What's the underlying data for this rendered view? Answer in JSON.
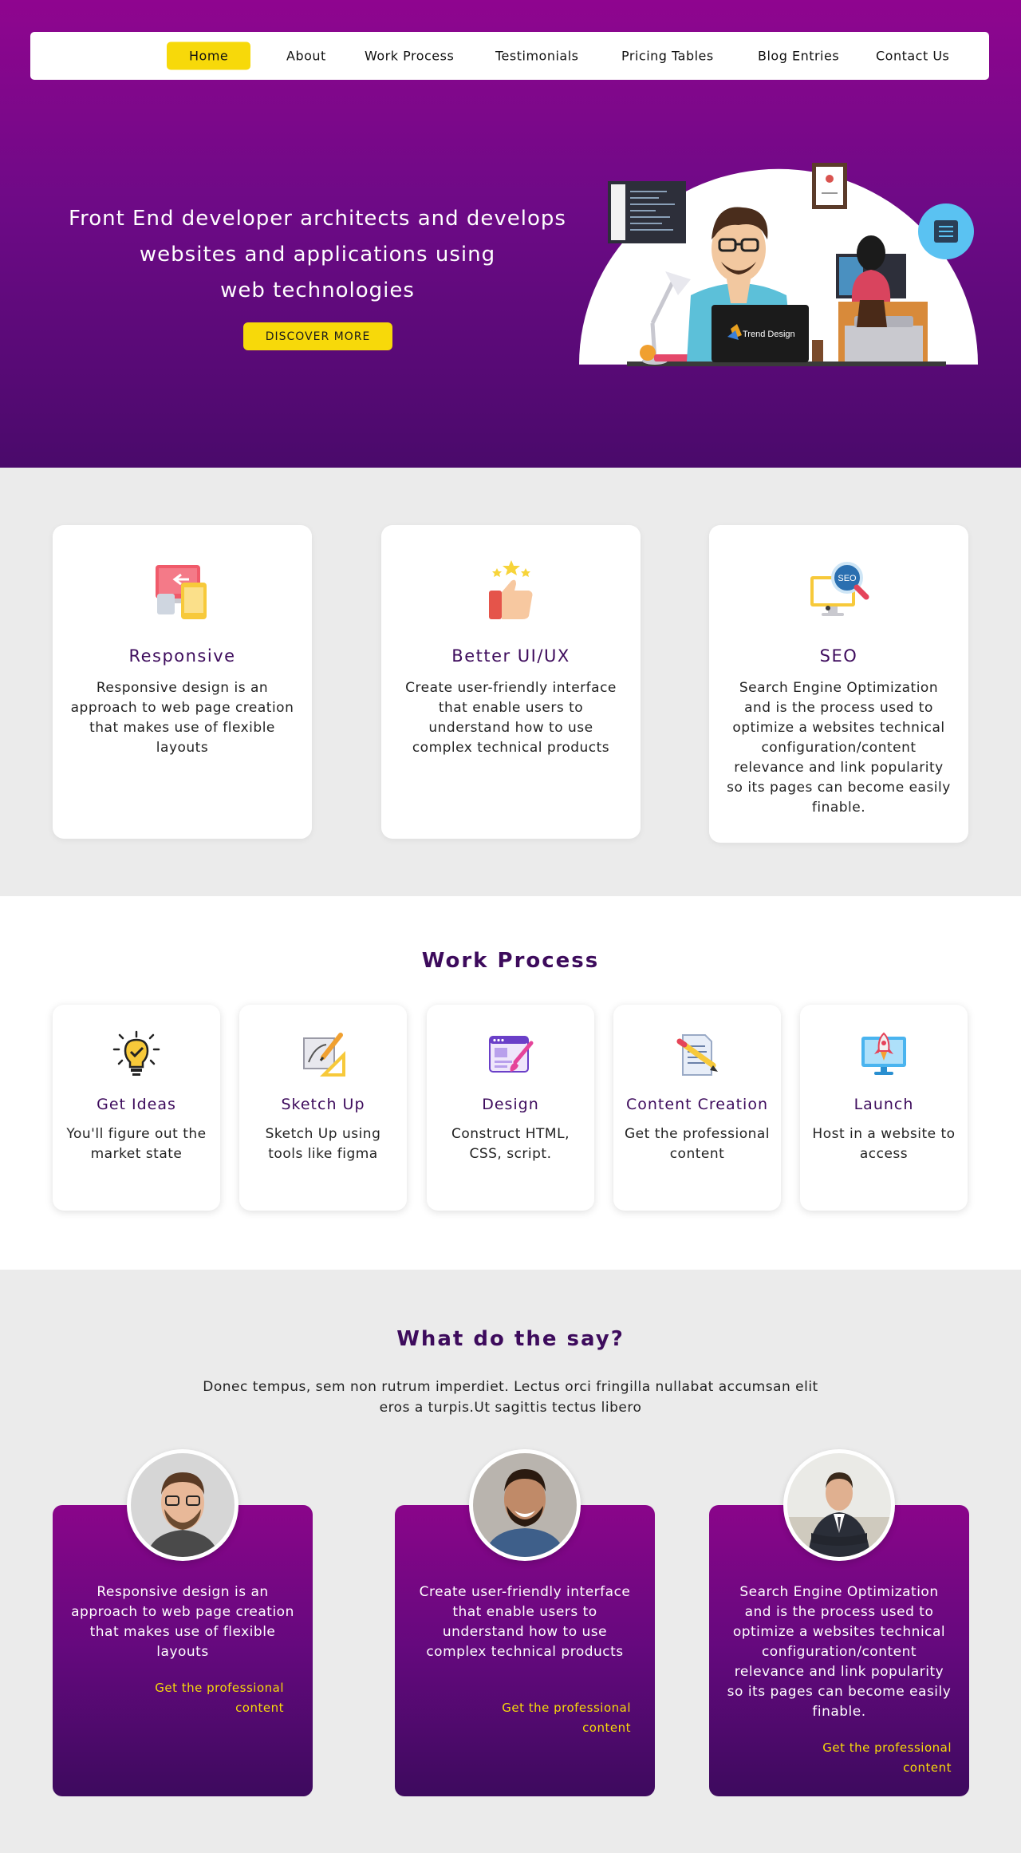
{
  "nav": {
    "items": [
      "Home",
      "About",
      "Work Process",
      "Testimonials",
      "Pricing Tables",
      "Blog Entries",
      "Contact Us"
    ],
    "active": "Home"
  },
  "hero": {
    "title_lines": [
      "Front End  developer architects and develops",
      "websites and applications using",
      "web technologies"
    ],
    "button": "DISCOVER MORE",
    "laptop_label": "Trend Design"
  },
  "features": [
    {
      "title": "Responsive",
      "icon": "responsive-devices-icon",
      "description": "Responsive design is an approach to web page creation  that makes use of  flexible layouts"
    },
    {
      "title": "Better UI/UX",
      "icon": "thumbs-up-stars-icon",
      "description": "Create user-friendly interface that enable users to understand how to use complex technical products"
    },
    {
      "title": "SEO",
      "icon": "seo-monitor-icon",
      "description": "Search Engine Optimization and is the process used to optimize a websites technical configuration/content relevance and link popularity so its pages can become easily finable."
    }
  ],
  "seo_badge": "SEO",
  "work_process": {
    "title": "Work Process",
    "steps": [
      {
        "title": "Get Ideas",
        "icon": "lightbulb-icon",
        "description": "You'll figure out the market state"
      },
      {
        "title": "Sketch Up",
        "icon": "sketch-ruler-icon",
        "description": "Sketch Up using tools like figma"
      },
      {
        "title": "Design",
        "icon": "design-brush-icon",
        "description": "Construct HTML, CSS, script."
      },
      {
        "title": "Content Creation",
        "icon": "document-pencil-icon",
        "description": "Get the professional content"
      },
      {
        "title": "Launch",
        "icon": "rocket-monitor-icon",
        "description": "Host in a website to access"
      }
    ]
  },
  "testimonials": {
    "title": "What do the say?",
    "subtitle": "Donec tempus, sem non rutrum imperdiet. Lectus orci fringilla nullabat accumsan elit eros a turpis.Ut sagittis tectus libero",
    "items": [
      {
        "quote": "Responsive design is an approach to web page creation  that makes use of  flexible layouts",
        "link": "Get the professional content"
      },
      {
        "quote": "Create user-friendly interface that enable users to understand how to use complex technical products",
        "link": "Get the professional content"
      },
      {
        "quote": "Search Engine Optimization and is the process used to optimize a websites technical configuration/content relevance and link popularity so its pages can become easily finable.",
        "link": "Get the professional content"
      }
    ]
  },
  "colors": {
    "hero_top": "#8f058f",
    "hero_bottom": "#4a0a6b",
    "accent_yellow": "#f7d90a",
    "heading_purple": "#3d0b5c"
  }
}
